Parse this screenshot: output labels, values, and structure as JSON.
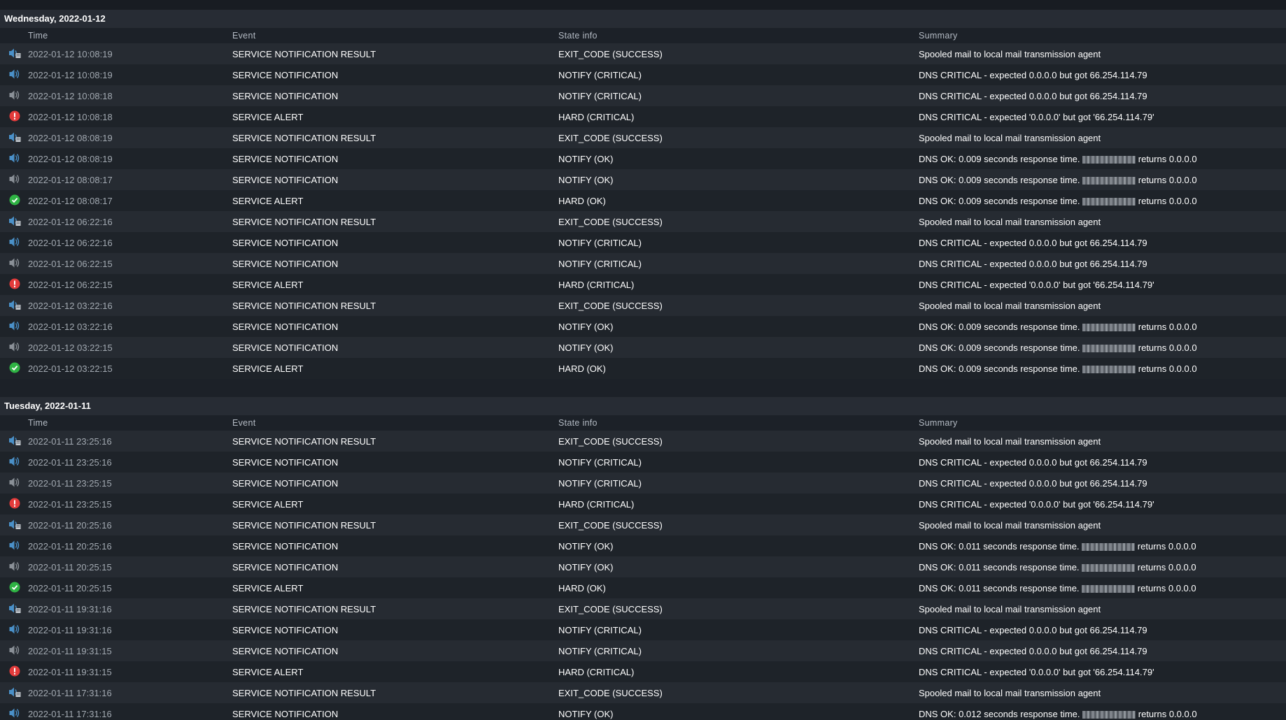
{
  "columns": {
    "time": "Time",
    "event": "Event",
    "state": "State info",
    "summary": "Summary"
  },
  "colors": {
    "critical": "#e33b3b",
    "ok": "#2fb344",
    "notify_blue": "#4a90c8",
    "notify_grey": "#8a9097"
  },
  "days": [
    {
      "header": "Wednesday, 2022-01-12",
      "rows": [
        {
          "icon": "notification-result-icon",
          "time": "2022-01-12 10:08:19",
          "event": "SERVICE NOTIFICATION RESULT",
          "state": "EXIT_CODE (SUCCESS)",
          "summary": "Spooled mail to local mail transmission agent"
        },
        {
          "icon": "notification-sent-icon",
          "time": "2022-01-12 10:08:19",
          "event": "SERVICE NOTIFICATION",
          "state": "NOTIFY (CRITICAL)",
          "summary": "DNS CRITICAL - expected 0.0.0.0 but got 66.254.114.79"
        },
        {
          "icon": "notification-icon",
          "time": "2022-01-12 10:08:18",
          "event": "SERVICE NOTIFICATION",
          "state": "NOTIFY (CRITICAL)",
          "summary": "DNS CRITICAL - expected 0.0.0.0 but got 66.254.114.79"
        },
        {
          "icon": "critical-icon",
          "time": "2022-01-12 10:08:18",
          "event": "SERVICE ALERT",
          "state": "HARD (CRITICAL)",
          "summary": "DNS CRITICAL - expected '0.0.0.0' but got '66.254.114.79'"
        },
        {
          "icon": "notification-result-icon",
          "time": "2022-01-12 08:08:19",
          "event": "SERVICE NOTIFICATION RESULT",
          "state": "EXIT_CODE (SUCCESS)",
          "summary": "Spooled mail to local mail transmission agent"
        },
        {
          "icon": "notification-sent-icon",
          "time": "2022-01-12 08:08:19",
          "event": "SERVICE NOTIFICATION",
          "state": "NOTIFY (OK)",
          "summary_pre": "DNS OK: 0.009 seconds response time.",
          "summary_post": "returns 0.0.0.0"
        },
        {
          "icon": "notification-icon",
          "time": "2022-01-12 08:08:17",
          "event": "SERVICE NOTIFICATION",
          "state": "NOTIFY (OK)",
          "summary_pre": "DNS OK: 0.009 seconds response time.",
          "summary_post": "returns 0.0.0.0"
        },
        {
          "icon": "ok-icon",
          "time": "2022-01-12 08:08:17",
          "event": "SERVICE ALERT",
          "state": "HARD (OK)",
          "summary_pre": "DNS OK: 0.009 seconds response time.",
          "summary_post": "returns 0.0.0.0"
        },
        {
          "icon": "notification-result-icon",
          "time": "2022-01-12 06:22:16",
          "event": "SERVICE NOTIFICATION RESULT",
          "state": "EXIT_CODE (SUCCESS)",
          "summary": "Spooled mail to local mail transmission agent"
        },
        {
          "icon": "notification-sent-icon",
          "time": "2022-01-12 06:22:16",
          "event": "SERVICE NOTIFICATION",
          "state": "NOTIFY (CRITICAL)",
          "summary": "DNS CRITICAL - expected 0.0.0.0 but got 66.254.114.79"
        },
        {
          "icon": "notification-icon",
          "time": "2022-01-12 06:22:15",
          "event": "SERVICE NOTIFICATION",
          "state": "NOTIFY (CRITICAL)",
          "summary": "DNS CRITICAL - expected 0.0.0.0 but got 66.254.114.79"
        },
        {
          "icon": "critical-icon",
          "time": "2022-01-12 06:22:15",
          "event": "SERVICE ALERT",
          "state": "HARD (CRITICAL)",
          "summary": "DNS CRITICAL - expected '0.0.0.0' but got '66.254.114.79'"
        },
        {
          "icon": "notification-result-icon",
          "time": "2022-01-12 03:22:16",
          "event": "SERVICE NOTIFICATION RESULT",
          "state": "EXIT_CODE (SUCCESS)",
          "summary": "Spooled mail to local mail transmission agent"
        },
        {
          "icon": "notification-sent-icon",
          "time": "2022-01-12 03:22:16",
          "event": "SERVICE NOTIFICATION",
          "state": "NOTIFY (OK)",
          "summary_pre": "DNS OK: 0.009 seconds response time.",
          "summary_post": "returns 0.0.0.0"
        },
        {
          "icon": "notification-icon",
          "time": "2022-01-12 03:22:15",
          "event": "SERVICE NOTIFICATION",
          "state": "NOTIFY (OK)",
          "summary_pre": "DNS OK: 0.009 seconds response time.",
          "summary_post": "returns 0.0.0.0"
        },
        {
          "icon": "ok-icon",
          "time": "2022-01-12 03:22:15",
          "event": "SERVICE ALERT",
          "state": "HARD (OK)",
          "summary_pre": "DNS OK: 0.009 seconds response time.",
          "summary_post": "returns 0.0.0.0"
        }
      ]
    },
    {
      "header": "Tuesday, 2022-01-11",
      "rows": [
        {
          "icon": "notification-result-icon",
          "time": "2022-01-11 23:25:16",
          "event": "SERVICE NOTIFICATION RESULT",
          "state": "EXIT_CODE (SUCCESS)",
          "summary": "Spooled mail to local mail transmission agent"
        },
        {
          "icon": "notification-sent-icon",
          "time": "2022-01-11 23:25:16",
          "event": "SERVICE NOTIFICATION",
          "state": "NOTIFY (CRITICAL)",
          "summary": "DNS CRITICAL - expected 0.0.0.0 but got 66.254.114.79"
        },
        {
          "icon": "notification-icon",
          "time": "2022-01-11 23:25:15",
          "event": "SERVICE NOTIFICATION",
          "state": "NOTIFY (CRITICAL)",
          "summary": "DNS CRITICAL - expected 0.0.0.0 but got 66.254.114.79"
        },
        {
          "icon": "critical-icon",
          "time": "2022-01-11 23:25:15",
          "event": "SERVICE ALERT",
          "state": "HARD (CRITICAL)",
          "summary": "DNS CRITICAL - expected '0.0.0.0' but got '66.254.114.79'"
        },
        {
          "icon": "notification-result-icon",
          "time": "2022-01-11 20:25:16",
          "event": "SERVICE NOTIFICATION RESULT",
          "state": "EXIT_CODE (SUCCESS)",
          "summary": "Spooled mail to local mail transmission agent"
        },
        {
          "icon": "notification-sent-icon",
          "time": "2022-01-11 20:25:16",
          "event": "SERVICE NOTIFICATION",
          "state": "NOTIFY (OK)",
          "summary_pre": "DNS OK: 0.011 seconds response time.",
          "summary_post": "returns 0.0.0.0"
        },
        {
          "icon": "notification-icon",
          "time": "2022-01-11 20:25:15",
          "event": "SERVICE NOTIFICATION",
          "state": "NOTIFY (OK)",
          "summary_pre": "DNS OK: 0.011 seconds response time.",
          "summary_post": "returns 0.0.0.0"
        },
        {
          "icon": "ok-icon",
          "time": "2022-01-11 20:25:15",
          "event": "SERVICE ALERT",
          "state": "HARD (OK)",
          "summary_pre": "DNS OK: 0.011 seconds response time.",
          "summary_post": "returns 0.0.0.0"
        },
        {
          "icon": "notification-result-icon",
          "time": "2022-01-11 19:31:16",
          "event": "SERVICE NOTIFICATION RESULT",
          "state": "EXIT_CODE (SUCCESS)",
          "summary": "Spooled mail to local mail transmission agent"
        },
        {
          "icon": "notification-sent-icon",
          "time": "2022-01-11 19:31:16",
          "event": "SERVICE NOTIFICATION",
          "state": "NOTIFY (CRITICAL)",
          "summary": "DNS CRITICAL - expected 0.0.0.0 but got 66.254.114.79"
        },
        {
          "icon": "notification-icon",
          "time": "2022-01-11 19:31:15",
          "event": "SERVICE NOTIFICATION",
          "state": "NOTIFY (CRITICAL)",
          "summary": "DNS CRITICAL - expected 0.0.0.0 but got 66.254.114.79"
        },
        {
          "icon": "critical-icon",
          "time": "2022-01-11 19:31:15",
          "event": "SERVICE ALERT",
          "state": "HARD (CRITICAL)",
          "summary": "DNS CRITICAL - expected '0.0.0.0' but got '66.254.114.79'"
        },
        {
          "icon": "notification-result-icon",
          "time": "2022-01-11 17:31:16",
          "event": "SERVICE NOTIFICATION RESULT",
          "state": "EXIT_CODE (SUCCESS)",
          "summary": "Spooled mail to local mail transmission agent"
        },
        {
          "icon": "notification-sent-icon",
          "time": "2022-01-11 17:31:16",
          "event": "SERVICE NOTIFICATION",
          "state": "NOTIFY (OK)",
          "summary_pre": "DNS OK: 0.012 seconds response time.",
          "summary_post": "returns 0.0.0.0"
        }
      ]
    }
  ]
}
